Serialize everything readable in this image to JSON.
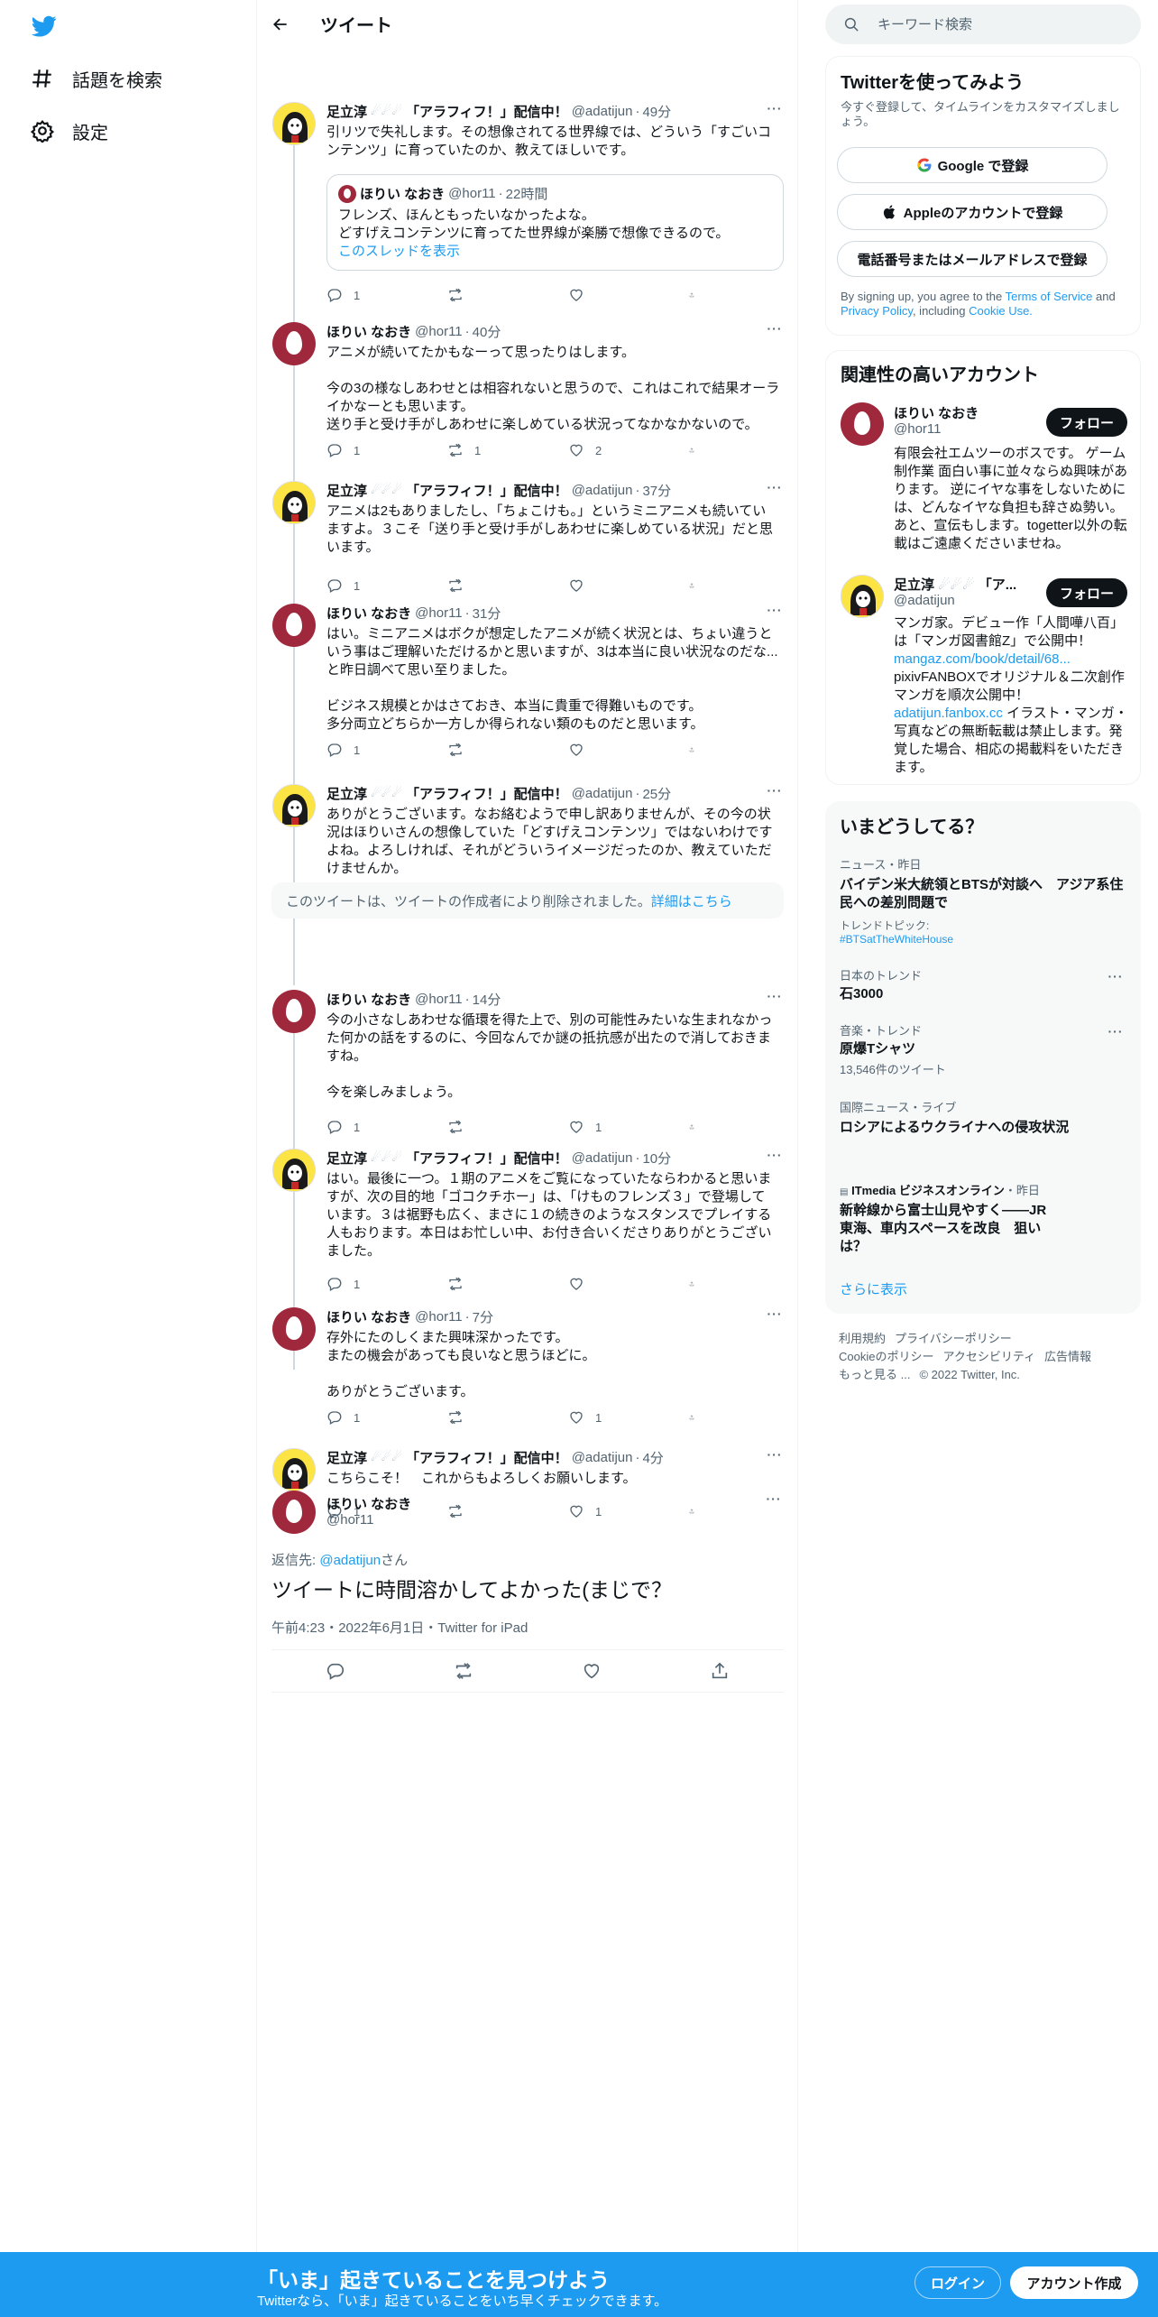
{
  "nav": {
    "logo": "twitter-bird",
    "items": [
      {
        "label": "話題を検索",
        "icon": "hashtag-icon"
      },
      {
        "label": "設定",
        "icon": "gear-icon"
      }
    ]
  },
  "header": {
    "title": "ツイート"
  },
  "tweets": [
    {
      "name": "足立淳",
      "name_suffix": "「アラフィフ！」配信中！",
      "handle": "@adatijun",
      "time": "49分",
      "text": "引リツで失礼します。その想像されてる世界線では、どういう「すごいコ\nンテンツ」に育っていたのか、教えてほしいです。",
      "replies": "1",
      "retweets": "",
      "likes": ""
    },
    {
      "name": "ほりい なおき",
      "handle": "@hor11",
      "time": "40分",
      "text": "アニメが続いてたかもなーって思ったりはします。\n\n今の3の様なしあわせとは相容れないと思うので、これはこれで結果オーラ\nイかなーとも思います。\n送り手と受け手がしあわせに楽しめている状況ってなかなかないので。",
      "replies": "1",
      "retweets": "1",
      "likes": "2"
    },
    {
      "name": "足立淳",
      "name_suffix": "「アラフィフ！」配信中！",
      "handle": "@adatijun",
      "time": "37分",
      "text": "アニメは2もありましたし、「ちょこけも。」というミニアニメも続いてい\nますよ。３こそ「送り手と受け手がしあわせに楽しめている状況」だと思\nいます。",
      "replies": "1",
      "retweets": "",
      "likes": ""
    },
    {
      "name": "ほりい なおき",
      "handle": "@hor11",
      "time": "31分",
      "text": "はい。ミニアニメはボクが想定したアニメが続く状況とは、ちょい違うと\nいう事はご理解いただけるかと思いますが、3は本当に良い状況なのだな...\nと昨日調べて思い至りました。\n\nビジネス規模とかはさておき、本当に貴重で得難いものです。\n多分両立どちらか一方しか得られない類のものだと思います。",
      "replies": "1",
      "retweets": "",
      "likes": ""
    },
    {
      "name": "足立淳",
      "name_suffix": "「アラフィフ！」配信中！",
      "handle": "@adatijun",
      "time": "25分",
      "text": "ありがとうございます。なお絡むようで申し訳ありませんが、その今の状\n況はほりいさんの想像していた「どすげえコンテンツ」ではないわけです\nよね。よろしければ、それがどういうイメージだったのか、教えていただ\nけませんか。",
      "replies": "",
      "retweets": "",
      "likes": ""
    },
    {
      "name": "ほりい なおき",
      "handle": "@hor11",
      "time": "14分",
      "text": "今の小さなしあわせな循環を得た上で、別の可能性みたいな生まれなかっ\nた何かの話をするのに、今回なんでか謎の抵抗感が出たので消しておきま\nすね。\n\n今を楽しみましょう。",
      "replies": "1",
      "retweets": "",
      "likes": "1"
    },
    {
      "name": "足立淳",
      "name_suffix": "「アラフィフ！」配信中！",
      "handle": "@adatijun",
      "time": "10分",
      "text": "はい。最後に一つ。１期のアニメをご覧になっていたならわかると思いま\nすが、次の目的地「ゴコクチホー」は、「けものフレンズ３」で登場して\nいます。３は裾野も広く、まさに１の続きのようなスタンスでプレイする\n人もおります。本日はお忙しい中、お付き合いくださりありがとうござい\nました。",
      "replies": "1",
      "retweets": "",
      "likes": ""
    },
    {
      "name": "ほりい なおき",
      "handle": "@hor11",
      "time": "7分",
      "text": "存外にたのしくまた興味深かったです。\nまたの機会があっても良いなと思うほどに。\n\nありがとうございます。",
      "replies": "1",
      "retweets": "",
      "likes": "1"
    },
    {
      "name": "足立淳",
      "name_suffix": "「アラフィフ！」配信中！",
      "handle": "@adatijun",
      "time": "4分",
      "text": "こちらこそ！　これからもよろしくお願いします。",
      "replies": "1",
      "retweets": "",
      "likes": "1"
    }
  ],
  "quote": {
    "name": "ほりい なおき",
    "handle": "@hor11",
    "time": "22時間",
    "text": "フレンズ、ほんともったいなかったよな。\nどすげえコンテンツに育ってた世界線が楽勝で想像できるので。",
    "link": "このスレッドを表示"
  },
  "deleted": {
    "text": "このツイートは、ツイートの作成者により削除されました。",
    "link": "詳細はこちら"
  },
  "focused": {
    "name": "ほりい なおき",
    "handle": "@hor11",
    "reply_prefix": "返信先: ",
    "reply_to": "@adatijun",
    "reply_suffix": "さん",
    "text": "ツイートに時間溶かしてよかった(まじで？",
    "meta": "午前4:23・2022年6月1日・Twitter for iPad"
  },
  "search": {
    "placeholder": "キーワード検索"
  },
  "signup_panel": {
    "title": "Twitterを使ってみよう",
    "subtitle": "今すぐ登録して、タイムラインをカスタマイズしましょう。",
    "google": "Google で登録",
    "apple": "Appleのアカウントで登録",
    "phone": "電話番号またはメールアドレスで登録",
    "terms_prefix": "By signing up, you agree to the ",
    "terms": "Terms of Service",
    "and": " and ",
    "privacy": "Privacy Policy",
    "including": ", including ",
    "cookie": "Cookie Use."
  },
  "related": {
    "title": "関連性の高いアカウント",
    "follow": "フォロー",
    "accounts": [
      {
        "name": "ほりい なおき",
        "handle": "@hor11",
        "bio": "有限会社エムツーのボスです。 ゲーム制作業 面白い事に並々ならぬ興味があります。 逆にイヤな事をしないためには、どんなイヤな負担も辞さぬ勢い。あと、宣伝もします。togetter以外の転載はご遠慮くださいませね。"
      },
      {
        "name": "足立淳",
        "name_suffix": "「ア...",
        "handle": "@adatijun",
        "bio1": "マンガ家。デビュー作「人間嘩八百」は「マンガ図書館Z」で公開中！",
        "link1": "mangaz.com/book/detail/68...",
        "bio2": "pixivFANBOXでオリジナル＆二次創作マンガを順次公開中！",
        "link2": "adatijun.fanbox.cc",
        "bio3": " イラスト・マンガ・写真などの無断転載は禁止します。発覚した場合、相応の掲載料をいただきます。"
      }
    ]
  },
  "trends": {
    "title": "いまどうしてる？",
    "items": [
      {
        "cat": "ニュース・昨日",
        "title": "バイデン米大統領とBTSが対談へ　アジア系住民への差別問題で",
        "sub_label": "トレンドトピック: ",
        "sub_link": "#BTSatTheWhiteHouse"
      },
      {
        "cat": "日本のトレンド",
        "title": "石3000"
      },
      {
        "cat": "音楽・トレンド",
        "title": "原爆Tシャツ",
        "count": "13,546件のツイート"
      },
      {
        "cat": "国際ニュース・ライブ",
        "title": "ロシアによるウクライナへの侵攻状況"
      },
      {
        "source": "ITmedia ビジネスオンライン",
        "when": "・昨日",
        "title": "新幹線から富士山見やすく――JR東海、車内スペースを改良　狙いは？"
      }
    ],
    "show_more": "さらに表示"
  },
  "footer": {
    "links": [
      "利用規約",
      "プライバシーポリシー",
      "Cookieのポリシー",
      "アクセシビリティ",
      "広告情報",
      "もっと見る ...",
      "© 2022 Twitter, Inc."
    ]
  },
  "bottom_bar": {
    "title": "「いま」起きていることを見つけよう",
    "subtitle": "Twitterなら、「いま」起きていることをいち早くチェックできます。",
    "login": "ログイン",
    "signup": "アカウント作成"
  },
  "colors": {
    "accent": "#1d9bf0",
    "text": "#0f1419",
    "muted": "#536471",
    "border": "#eff3f4"
  }
}
